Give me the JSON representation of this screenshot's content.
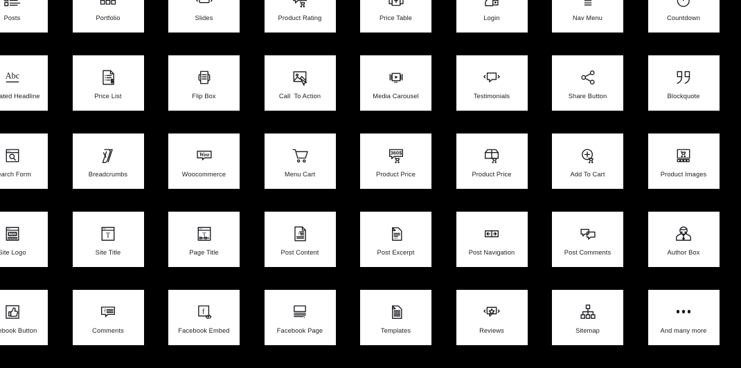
{
  "background_color": "#000000",
  "card_color": "#ffffff",
  "icon_color": "#16181d",
  "label_color": "#1b1d22",
  "grid": {
    "columns": 8,
    "rows": 5,
    "widgets": [
      {
        "label": "Posts",
        "icon": "posts-list-icon"
      },
      {
        "label": "Portfolio",
        "icon": "portfolio-grid-icon"
      },
      {
        "label": "Slides",
        "icon": "slides-carousel-icon"
      },
      {
        "label": "Product Rating",
        "icon": "product-rating-stars-icon"
      },
      {
        "label": "Price Table",
        "icon": "price-table-dollar-icon"
      },
      {
        "label": "Login",
        "icon": "login-user-lock-icon"
      },
      {
        "label": "Nav Menu",
        "icon": "nav-menu-bars-icon"
      },
      {
        "label": "Countdown",
        "icon": "countdown-stopwatch-icon"
      },
      {
        "label": "Animated Headline",
        "icon": "animated-headline-abc-icon"
      },
      {
        "label": "Price List",
        "icon": "price-list-document-icon"
      },
      {
        "label": "Flip Box",
        "icon": "flip-box-icon"
      },
      {
        "label": "Call  To Action",
        "icon": "call-to-action-image-cursor-icon"
      },
      {
        "label": "Media Carousel",
        "icon": "media-carousel-play-icon"
      },
      {
        "label": "Testimonials",
        "icon": "testimonials-quote-bubble-icon"
      },
      {
        "label": "Share Button",
        "icon": "share-button-nodes-icon"
      },
      {
        "label": "Blockquote",
        "icon": "blockquote-quotes-icon"
      },
      {
        "label": "Search Form",
        "icon": "search-form-magnifier-icon"
      },
      {
        "label": "Breadcrumbs",
        "icon": "breadcrumbs-yoast-icon"
      },
      {
        "label": "Woocommerce",
        "icon": "woocommerce-woo-icon"
      },
      {
        "label": "Menu Cart",
        "icon": "menu-cart-trolley-icon"
      },
      {
        "label": "Product Price",
        "icon": "product-price-360-icon"
      },
      {
        "label": "Product Price",
        "icon": "product-price-box-icon"
      },
      {
        "label": "Add To Cart",
        "icon": "add-to-cart-plus-icon"
      },
      {
        "label": "Product Images",
        "icon": "product-images-gallery-icon"
      },
      {
        "label": "Site Logo",
        "icon": "site-logo-browser-icon"
      },
      {
        "label": "Site Title",
        "icon": "site-title-browser-t-icon"
      },
      {
        "label": "Page Title",
        "icon": "page-title-browser-t-icon"
      },
      {
        "label": "Post Content",
        "icon": "post-content-document-icon"
      },
      {
        "label": "Post Excerpt",
        "icon": "post-excerpt-document-icon"
      },
      {
        "label": "Post Navigation",
        "icon": "post-navigation-arrows-icon"
      },
      {
        "label": "Post Comments",
        "icon": "post-comments-bubbles-icon"
      },
      {
        "label": "Author Box",
        "icon": "author-box-person-icon"
      },
      {
        "label": "Facebook Button",
        "icon": "facebook-button-thumb-icon"
      },
      {
        "label": "Comments",
        "icon": "comments-bubble-lines-icon"
      },
      {
        "label": "Facebook Embed",
        "icon": "facebook-embed-code-icon"
      },
      {
        "label": "Facebook Page",
        "icon": "facebook-page-icon"
      },
      {
        "label": "Templates",
        "icon": "templates-document-icon"
      },
      {
        "label": "Reviews",
        "icon": "reviews-star-bubble-icon"
      },
      {
        "label": "Sitemap",
        "icon": "sitemap-hierarchy-icon"
      },
      {
        "label": "And many more",
        "icon": "ellipsis-dots-icon"
      }
    ]
  }
}
